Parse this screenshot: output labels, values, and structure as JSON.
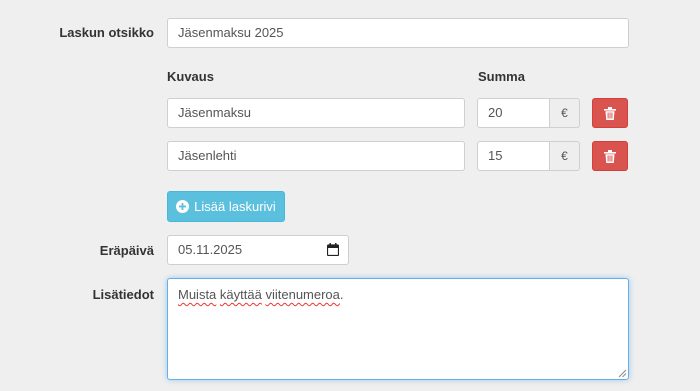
{
  "form": {
    "title_label": "Laskun otsikko",
    "title_value": "Jäsenmaksu 2025",
    "columns": {
      "description": "Kuvaus",
      "amount": "Summa"
    },
    "rows": [
      {
        "description": "Jäsenmaksu",
        "amount": "20",
        "currency": "€"
      },
      {
        "description": "Jäsenlehti",
        "amount": "15",
        "currency": "€"
      }
    ],
    "add_row_label": "Lisää laskurivi",
    "due_label": "Eräpäivä",
    "due_value": "05.11.2025",
    "notes_label": "Lisätiedot",
    "notes_words": [
      "Muista",
      "käyttää",
      "viitenumeroa",
      "."
    ]
  },
  "colors": {
    "danger": "#d9534f",
    "info": "#5bc0de",
    "focus": "#66afe9"
  }
}
